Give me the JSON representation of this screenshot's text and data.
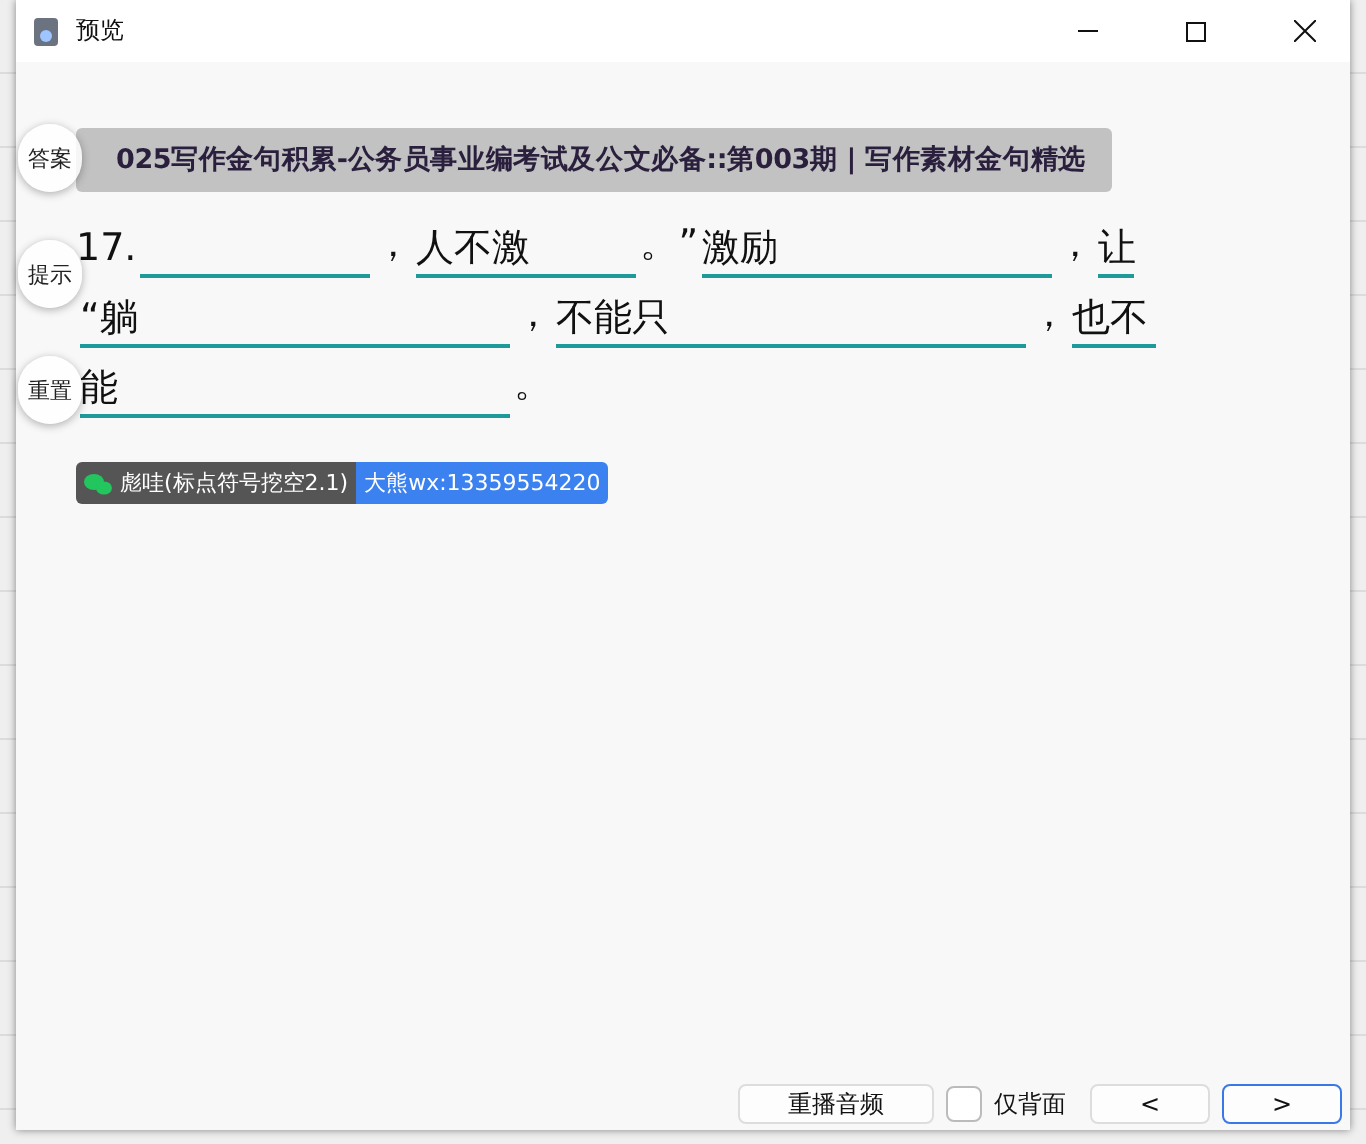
{
  "window": {
    "title": "预览"
  },
  "float_buttons": [
    "答案",
    "提示",
    "重置"
  ],
  "title": "025写作金句积累-公务员事业编考试及公文必备::第003期 | 写作素材金句精选",
  "lines": [
    [
      {
        "kind": "text",
        "text": "17."
      },
      {
        "kind": "blank"
      },
      {
        "kind": "text",
        "text": "，"
      },
      {
        "kind": "blank",
        "hint": "人不激"
      },
      {
        "kind": "text",
        "text": "。”"
      },
      {
        "kind": "blank",
        "hint": "激励"
      },
      {
        "kind": "text",
        "text": "，"
      },
      {
        "kind": "blank",
        "hint": "让"
      }
    ],
    [
      {
        "kind": "blank",
        "hint": "“躺"
      },
      {
        "kind": "text",
        "text": "，"
      },
      {
        "kind": "blank",
        "hint": "不能只"
      },
      {
        "kind": "text",
        "text": "，"
      },
      {
        "kind": "blank",
        "hint": "也不"
      }
    ],
    [
      {
        "kind": "blank",
        "hint": "能"
      },
      {
        "kind": "text",
        "text": "。"
      }
    ]
  ],
  "badge": {
    "author": "彪哇(标点符号挖空2.1)",
    "contact": "大熊wx:13359554220"
  },
  "footer": {
    "replay": "重播音频",
    "back_only": {
      "label": "仅背面",
      "checked": false
    },
    "prev": "<",
    "next": ">"
  }
}
